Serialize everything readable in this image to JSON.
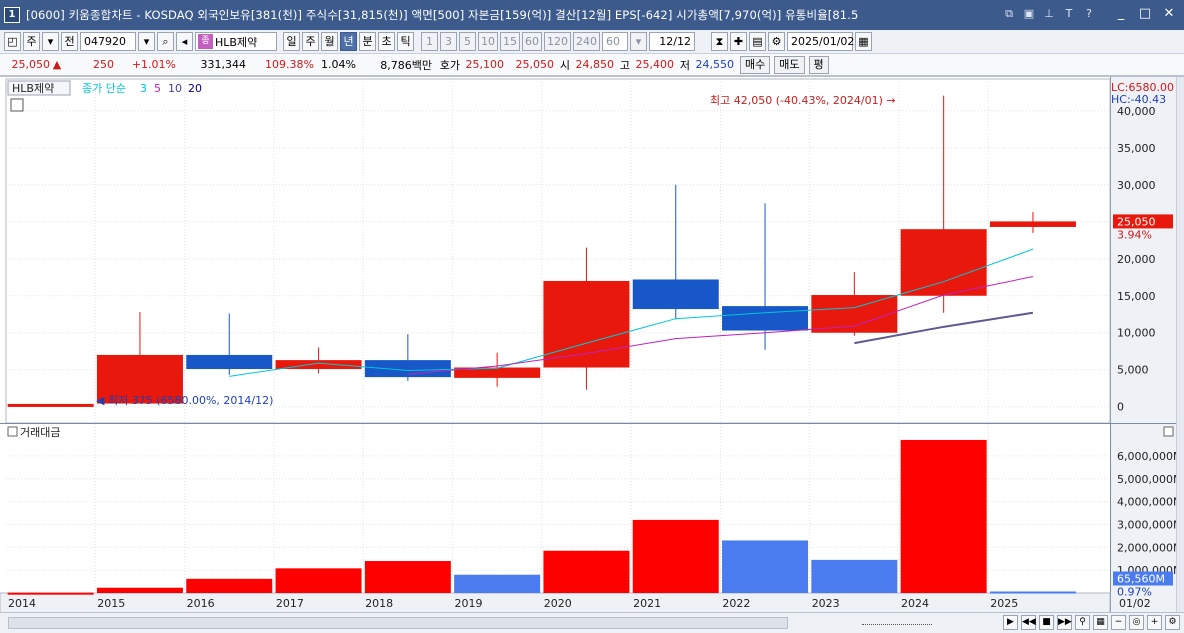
{
  "window": {
    "number": "1",
    "title": "[0600] 키움종합차트 - KOSDAQ 외국인보유[381(천)] 주식수[31,815(천)] 액면[500] 자본금[159(억)] 결산[12월] EPS[-642] 시가총액[7,970(억)] 유통비율[81.5",
    "icons": [
      "window-icon",
      "tile-icon",
      "pin-icon",
      "t-icon",
      "help-icon"
    ],
    "controls": [
      "_",
      "□",
      "✕"
    ]
  },
  "toolbar": {
    "code": "047920",
    "stock_badge": "종",
    "stock_name": "HLB제약",
    "period_buttons": [
      "일",
      "주",
      "월",
      "년",
      "분",
      "초",
      "틱"
    ],
    "selected_period": "년",
    "minute_buttons": [
      "1",
      "3",
      "5",
      "10",
      "15",
      "60",
      "120",
      "240"
    ],
    "interval_value": "60",
    "count_value": "12/12",
    "date_value": "2025/01/02",
    "left_buttons": [
      "주",
      "전"
    ]
  },
  "quote": {
    "price": "25,050",
    "arrow": "▲",
    "change": "250",
    "change_pct": "+1.01%",
    "volume": "331,344",
    "vol_ratio": "109.38%",
    "turnover": "1.04%",
    "amount": "8,786백만",
    "ask_label": "호가",
    "ask1": "25,100",
    "ask2": "25,050",
    "open_label": "시",
    "open": "24,850",
    "high_label": "고",
    "high": "25,400",
    "low_label": "저",
    "low": "24,550",
    "buy_button": "매수",
    "sell_button": "매도",
    "eval_button": "평"
  },
  "chart_data": [
    {
      "type": "candlestick",
      "title": "HLB제약",
      "legend": {
        "label": "종가 단순",
        "periods": [
          "3",
          "5",
          "10",
          "20"
        ],
        "colors": [
          "#00c8d8",
          "#c020c0",
          "#4040a0",
          "#000080"
        ]
      },
      "x": [
        "2014",
        "2015",
        "2016",
        "2017",
        "2018",
        "2019",
        "2020",
        "2021",
        "2022",
        "2023",
        "2024",
        "2025"
      ],
      "candles": [
        {
          "year": "2014",
          "open": 375,
          "high": 375,
          "low": 375,
          "close": 375
        },
        {
          "year": "2015",
          "open": 430,
          "high": 12800,
          "low": 430,
          "close": 7000
        },
        {
          "year": "2016",
          "open": 7000,
          "high": 12600,
          "low": 4300,
          "close": 5100
        },
        {
          "year": "2017",
          "open": 5100,
          "high": 8000,
          "low": 4500,
          "close": 6300
        },
        {
          "year": "2018",
          "open": 6300,
          "high": 9800,
          "low": 3500,
          "close": 4000
        },
        {
          "year": "2019",
          "open": 3900,
          "high": 7300,
          "low": 2700,
          "close": 5300
        },
        {
          "year": "2020",
          "open": 5300,
          "high": 21500,
          "low": 2300,
          "close": 17000
        },
        {
          "year": "2021",
          "open": 17200,
          "high": 30000,
          "low": 11800,
          "close": 13200
        },
        {
          "year": "2022",
          "open": 13600,
          "high": 27500,
          "low": 7700,
          "close": 10300
        },
        {
          "year": "2023",
          "open": 10000,
          "high": 18200,
          "low": 9600,
          "close": 15100
        },
        {
          "year": "2024",
          "open": 15000,
          "high": 42050,
          "low": 12700,
          "close": 24000
        },
        {
          "year": "2025",
          "open": 24300,
          "high": 26300,
          "low": 23500,
          "close": 25050
        }
      ],
      "ma": [
        {
          "period": "3",
          "color": "#00c8d8",
          "values": [
            null,
            null,
            4100,
            5900,
            4900,
            5200,
            8600,
            11900,
            12700,
            13400,
            16900,
            21300
          ]
        },
        {
          "period": "5",
          "color": "#c020c0",
          "values": [
            null,
            null,
            null,
            null,
            4400,
            5500,
            7200,
            9200,
            10000,
            10900,
            15100,
            17600
          ]
        },
        {
          "period": "10",
          "color": "#605890",
          "values": [
            null,
            null,
            null,
            null,
            null,
            null,
            null,
            null,
            null,
            8600,
            10800,
            12700
          ]
        }
      ],
      "y_ticks": [
        "40,000",
        "35,000",
        "30,000",
        "25,000",
        "20,000",
        "15,000",
        "10,000",
        "5,000",
        "0"
      ],
      "ylim": [
        -2200,
        44300
      ],
      "annotations": {
        "high_label": "최고 42,050 (-40.43%, 2024/01)",
        "low_label": "최저 375 (6580.00%, 2014/12)",
        "lc": "LC:6580.00",
        "hc": "HC:-40.43",
        "current_price": "25,050",
        "current_pct": "3.94%"
      }
    },
    {
      "type": "bar",
      "title": "거래대금",
      "x": [
        "2014",
        "2015",
        "2016",
        "2017",
        "2018",
        "2019",
        "2020",
        "2021",
        "2022",
        "2023",
        "2024",
        "2025"
      ],
      "values": [
        15000000,
        230000000,
        620000000,
        1080000000,
        1400000000,
        800000000,
        1850000000,
        3200000000,
        2300000000,
        1450000000,
        6700000000,
        65560000
      ],
      "colors": [
        "red",
        "red",
        "red",
        "red",
        "red",
        "blue",
        "red",
        "red",
        "blue",
        "blue",
        "red",
        "blue"
      ],
      "y_ticks": [
        "6,000,000M",
        "5,000,000M",
        "4,000,000M",
        "3,000,000M",
        "2,000,000M",
        "1,000,000M"
      ],
      "ylim": [
        0,
        6960000000
      ],
      "current_value": "65,560M",
      "current_pct": "0.97%"
    }
  ],
  "x_axis": {
    "labels": [
      "2014",
      "2015",
      "2016",
      "2017",
      "2018",
      "2019",
      "2020",
      "2021",
      "2022",
      "2023",
      "2024",
      "2025"
    ],
    "right_label": "01/02"
  },
  "colors": {
    "up": "#e8180c",
    "down": "#1757c8",
    "vol_up": "#ff0000",
    "vol_down": "#4a7cf0",
    "title_bar": "#3c5a8c"
  }
}
